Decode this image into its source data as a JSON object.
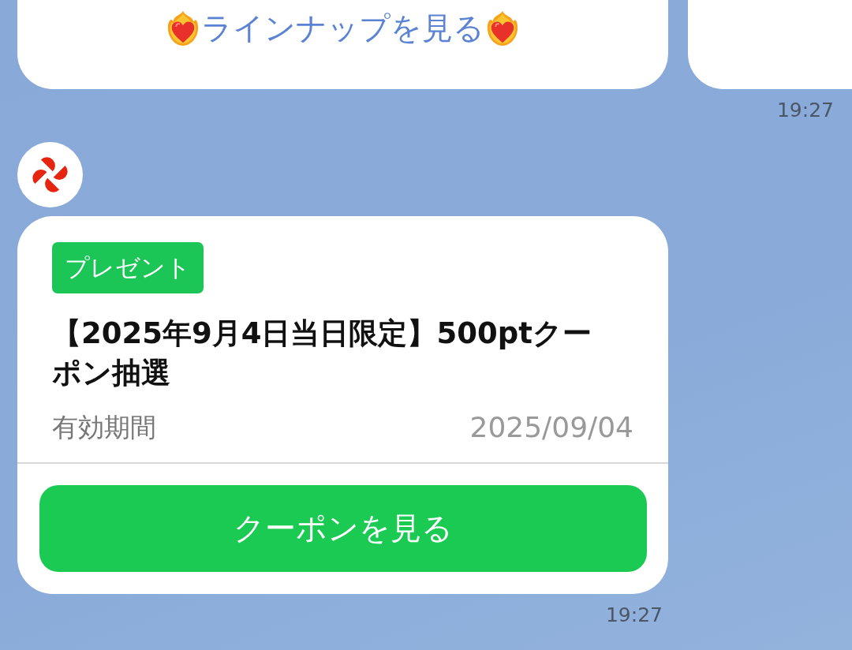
{
  "top_message": {
    "link": "ラインナップを見る",
    "time": "19:27"
  },
  "coupon_message": {
    "badge": "プレゼント",
    "title": "【2025年9月4日当日限定】500ptクーポン抽選",
    "validity_label": "有効期間",
    "validity_date": "2025/09/04",
    "button": "クーポンを見る",
    "time": "19:27"
  }
}
